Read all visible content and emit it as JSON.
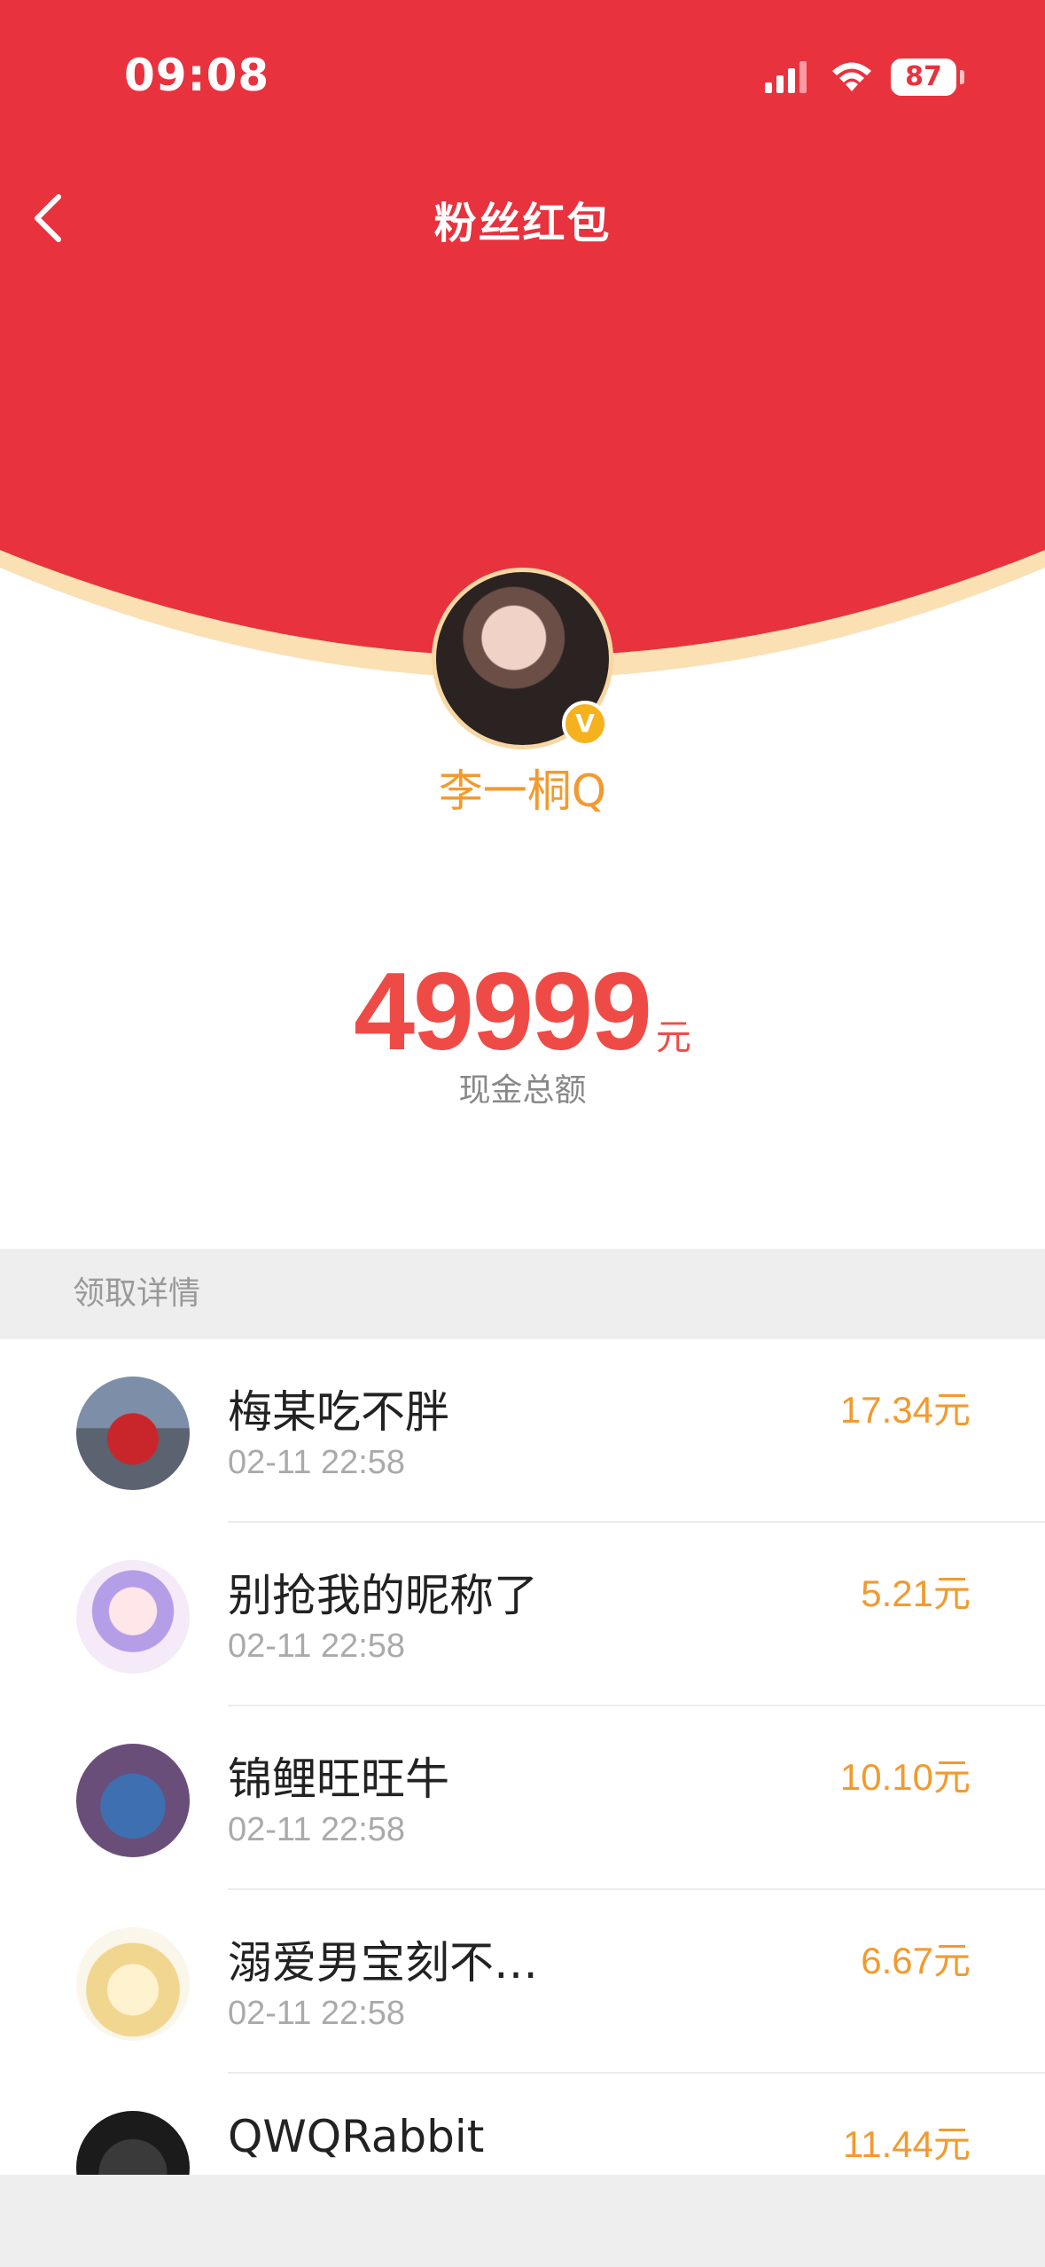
{
  "status_bar": {
    "time": "09:08",
    "battery": "87"
  },
  "nav": {
    "title": "粉丝红包"
  },
  "creator": {
    "name": "李一桐Q",
    "verified_icon_text": "V"
  },
  "summary": {
    "amount": "49999",
    "unit": "元",
    "label": "现金总额"
  },
  "section": {
    "title": "领取详情"
  },
  "receivers": [
    {
      "name": "梅某吃不胖",
      "time": "02-11 22:58",
      "amount": "17.34元"
    },
    {
      "name": "别抢我的昵称了",
      "time": "02-11 22:58",
      "amount": "5.21元"
    },
    {
      "name": "锦鲤旺旺牛",
      "time": "02-11 22:58",
      "amount": "10.10元"
    },
    {
      "name": "溺爱男宝刻不…",
      "time": "02-11 22:58",
      "amount": "6.67元"
    },
    {
      "name": "QWQRabbit",
      "time": "",
      "amount": "11.44元"
    }
  ],
  "colors": {
    "header_red": "#e8323e",
    "accent_orange": "#f29a2e",
    "amount_red": "#ef4b46"
  }
}
